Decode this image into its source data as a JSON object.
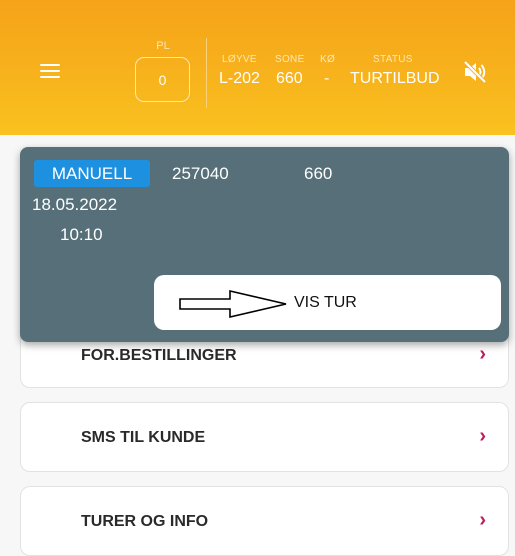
{
  "header": {
    "pl_label": "PL",
    "pl_value": "0",
    "loyve_label": "LØYVE",
    "loyve_value": "L-202",
    "sone_label": "SONE",
    "sone_value": "660",
    "ko_label": "KØ",
    "ko_value": "-",
    "status_label": "STATUS",
    "status_value": "TURTILBUD",
    "menu_icon": "hamburger-menu-icon",
    "sound_icon": "volume-muted-icon"
  },
  "offer": {
    "type_badge": "MANUELL",
    "trip_id": "257040",
    "zone": "660",
    "date": "18.05.2022",
    "time": "10:10",
    "action_label": "VIS TUR",
    "arrow_icon": "arrow-right-icon",
    "badge_color": "#1d91e0"
  },
  "menu_items": [
    {
      "label": "FOR.BESTILLINGER"
    },
    {
      "label": "SMS TIL KUNDE"
    },
    {
      "label": "TURER OG INFO"
    }
  ],
  "colors": {
    "header_accent": "#f7b21c",
    "overlay": "#566f78",
    "chevron": "#c2185b"
  }
}
